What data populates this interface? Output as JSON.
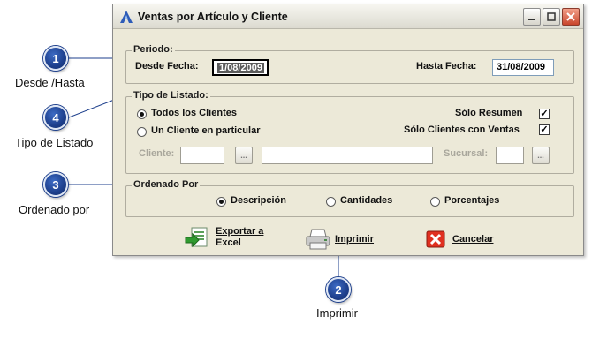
{
  "window": {
    "title": "Ventas por Artículo y Cliente"
  },
  "periodo": {
    "group_title": "Periodo:",
    "desde_label": "Desde Fecha:",
    "desde_value": "1/08/2009",
    "hasta_label": "Hasta Fecha:",
    "hasta_value": "31/08/2009"
  },
  "tipo_listado": {
    "group_title": "Tipo de Listado:",
    "todos_label": "Todos los Clientes",
    "un_cliente_label": "Un Cliente en particular",
    "solo_resumen_label": "Sólo Resumen",
    "solo_con_ventas_label": "Sólo Clientes con Ventas",
    "cliente_label": "Cliente:",
    "sucursal_label": "Sucursal:",
    "browse_label": "..."
  },
  "ordenado": {
    "group_title": "Ordenado Por",
    "descripcion_label": "Descripción",
    "cantidades_label": "Cantidades",
    "porcentajes_label": "Porcentajes"
  },
  "actions": {
    "exportar_line1": "Exportar a",
    "exportar_line2": "Excel",
    "imprimir_label": "Imprimir",
    "cancelar_label": "Cancelar"
  },
  "callouts": [
    {
      "number": "1",
      "label": "Desde /Hasta"
    },
    {
      "number": "4",
      "label": "Tipo de Listado"
    },
    {
      "number": "3",
      "label": "Ordenado por"
    },
    {
      "number": "2",
      "label": "Imprimir"
    }
  ],
  "colors": {
    "dialog_bg": "#ece9d8",
    "callout_blue": "#1d3f8c",
    "close_red": "#c9452b"
  }
}
